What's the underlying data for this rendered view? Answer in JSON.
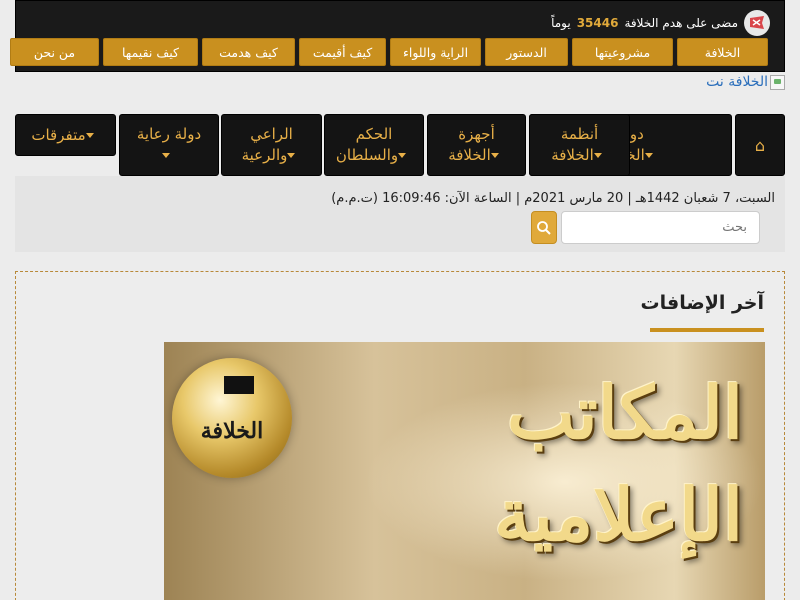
{
  "header": {
    "counter": {
      "prefix": "مضى على هدم الخلافة",
      "days": "35446",
      "suffix": "يوماً",
      "icon": "flag-icon"
    },
    "top_links": [
      "الخلافة",
      "مشروعيتها",
      "الدستور",
      "الراية واللواء",
      "كيف أقيمت",
      "كيف هدمت",
      "كيف نقيمها",
      "من نحن"
    ]
  },
  "logo": {
    "alt": "الخلافة نت"
  },
  "nav": {
    "home_icon": "home-icon",
    "items": [
      {
        "line1": "دولة",
        "line2": "الخلافة"
      },
      {
        "line1": "أنظمة",
        "line2": "الخلافة"
      },
      {
        "line1": "أجهزة",
        "line2": "الخلافة"
      },
      {
        "line1": "الحكم",
        "line2": "والسلطان"
      },
      {
        "line1": "الراعي",
        "line2": "والرعية"
      },
      {
        "line1": "دولة رعاية",
        "line2": ""
      },
      {
        "line1": "متفرقات",
        "line2": ""
      }
    ]
  },
  "info": {
    "date": "السبت، 7 شعبان 1442هـ | 20 مارس 2021م | الساعة الآن: 16:09:46 (ت.م.م)",
    "search_placeholder": "بحث"
  },
  "content": {
    "section_title": "آخر الإضافات",
    "banner": {
      "line1": "المكاتب",
      "line2": "الإعلامية",
      "globe_label": "الخلافة"
    }
  },
  "colors": {
    "gold": "#c9901f",
    "nav_text": "#e8b048",
    "dark": "#141414"
  }
}
